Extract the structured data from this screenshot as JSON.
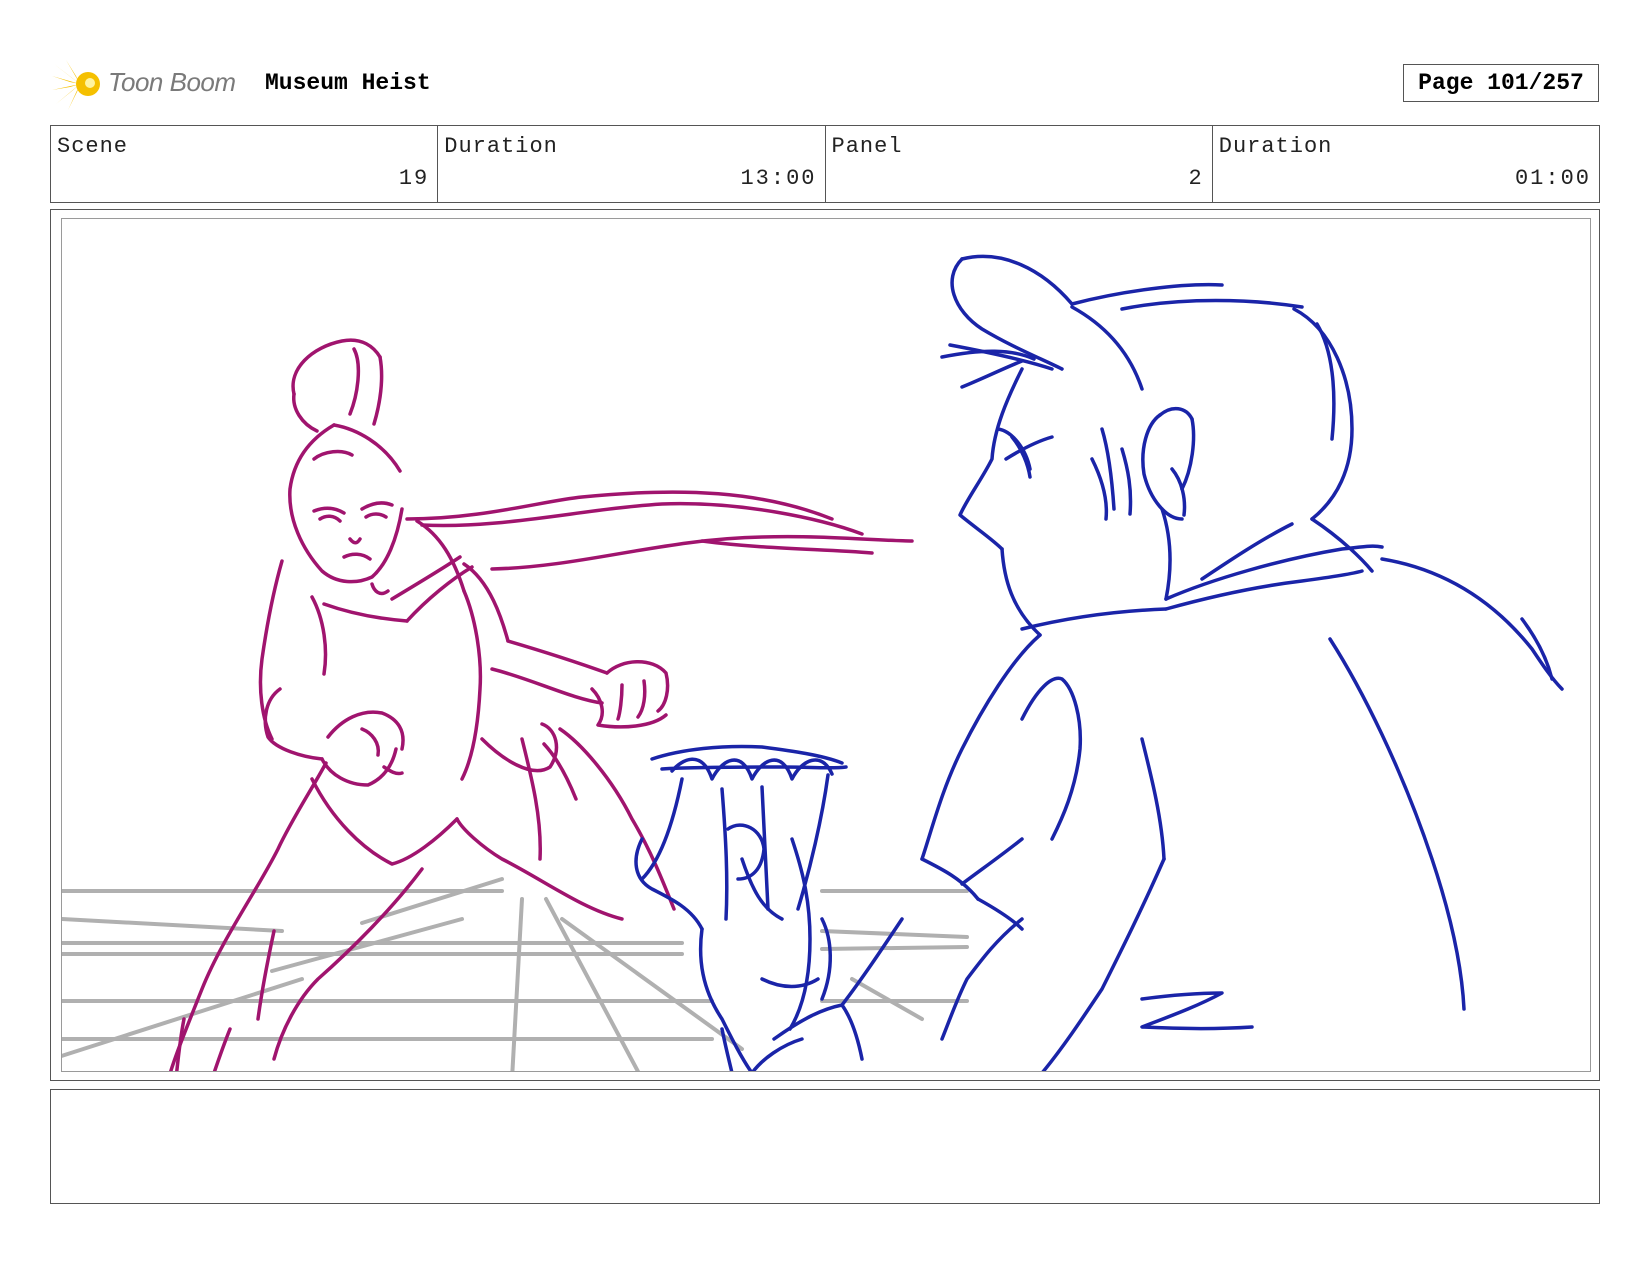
{
  "header": {
    "logo_text": "Toon Boom",
    "project_title": "Museum Heist",
    "page_label": "Page 101/257"
  },
  "info": {
    "scene_label": "Scene",
    "scene_value": "19",
    "scene_duration_label": "Duration",
    "scene_duration_value": "13:00",
    "panel_label": "Panel",
    "panel_value": "2",
    "panel_duration_label": "Duration",
    "panel_duration_value": "01:00"
  },
  "colors": {
    "logo_yellow": "#f5c000",
    "magenta_sketch": "#a0146e",
    "blue_sketch": "#1a24a8",
    "grid_gray": "#b0b0b0"
  },
  "caption": {
    "text": ""
  }
}
